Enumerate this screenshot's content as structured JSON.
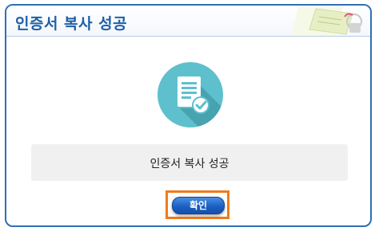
{
  "dialog": {
    "title": "인증서 복사 성공",
    "message": "인증서 복사 성공",
    "ok_label": "확인"
  },
  "icons": {
    "document": "document-check-icon",
    "title_art": "certificate-icon"
  },
  "colors": {
    "title": "#1f5fa8",
    "border": "#2f6fb3",
    "circle": "#5ec0cc",
    "button": "#1c5fc4",
    "highlight": "#f07a1a"
  }
}
